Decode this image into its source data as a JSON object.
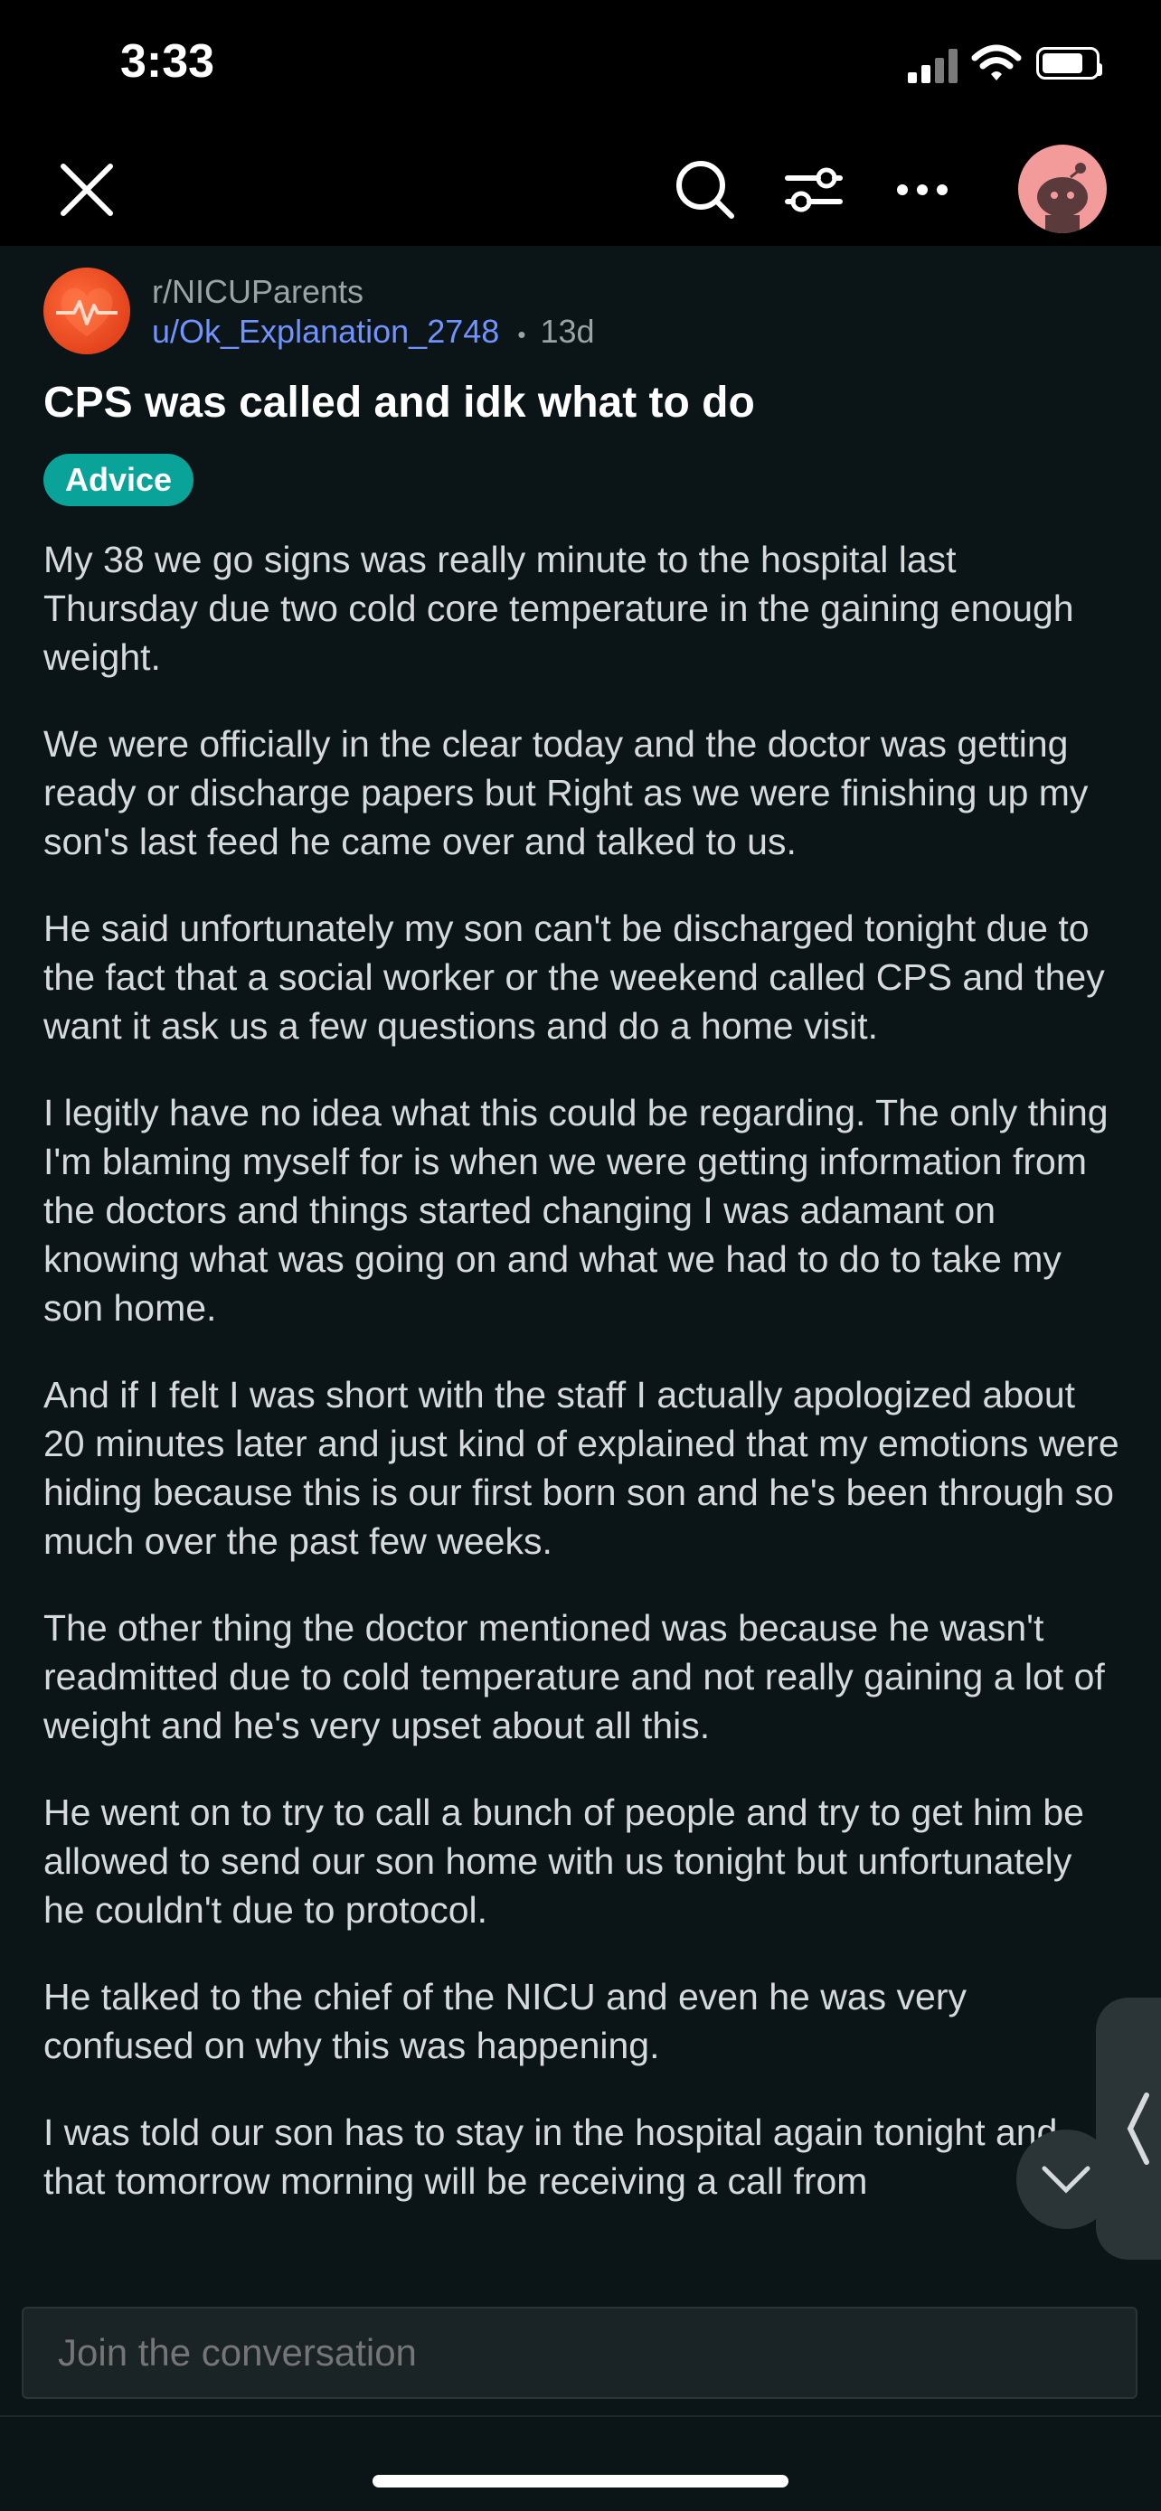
{
  "status_bar": {
    "time": "3:33"
  },
  "nav": {
    "close_icon": "close-icon",
    "search_icon": "search-icon",
    "filter_icon": "filter-icon",
    "more_icon": "more-icon",
    "avatar_icon": "snoo-avatar"
  },
  "post": {
    "subreddit": "r/NICUParents",
    "author": "u/Ok_Explanation_2748",
    "separator": "•",
    "age": "13d",
    "title": "CPS was called and idk what to do",
    "flair": "Advice",
    "paragraphs": [
      "My 38 we go signs was really minute to the hospital last Thursday due two cold core temperature in the gaining enough weight.",
      "We were officially in the clear today and the doctor was getting ready or discharge papers but Right as we were finishing up my son's last feed he came over and talked to us.",
      "He said unfortunately my son can't be discharged tonight due to the fact that a social worker or the weekend called CPS and they want it ask us a few questions and do a home visit.",
      "I legitly have no idea what this could be regarding. The only thing I'm blaming myself for is when we were getting information from the doctors and things started changing I was adamant on knowing what was going on and what we had to do to take my son home.",
      "And if I felt I was short with the staff I actually apologized about 20 minutes later and just kind of explained that my emotions were hiding because this is our first born son and he's been through so much over the past few weeks.",
      "The other thing the doctor mentioned was because he wasn't readmitted due to cold temperature and not really gaining a lot of weight and he's very upset about all this.",
      "He went on to try to call a bunch of people and try to get him be allowed to send our son home with us tonight but unfortunately he couldn't due to protocol.",
      "He talked to the chief of the NICU and even he was very confused on why this was happening.",
      "I was told our son has to stay in the hospital again tonight and that tomorrow morning will be receiving a call from"
    ]
  },
  "comment_box": {
    "placeholder": "Join the conversation"
  },
  "colors": {
    "background": "#0b1416",
    "flair": "#0aa39a",
    "username": "#7193ff",
    "subreddit_icon": "#e8431e"
  }
}
